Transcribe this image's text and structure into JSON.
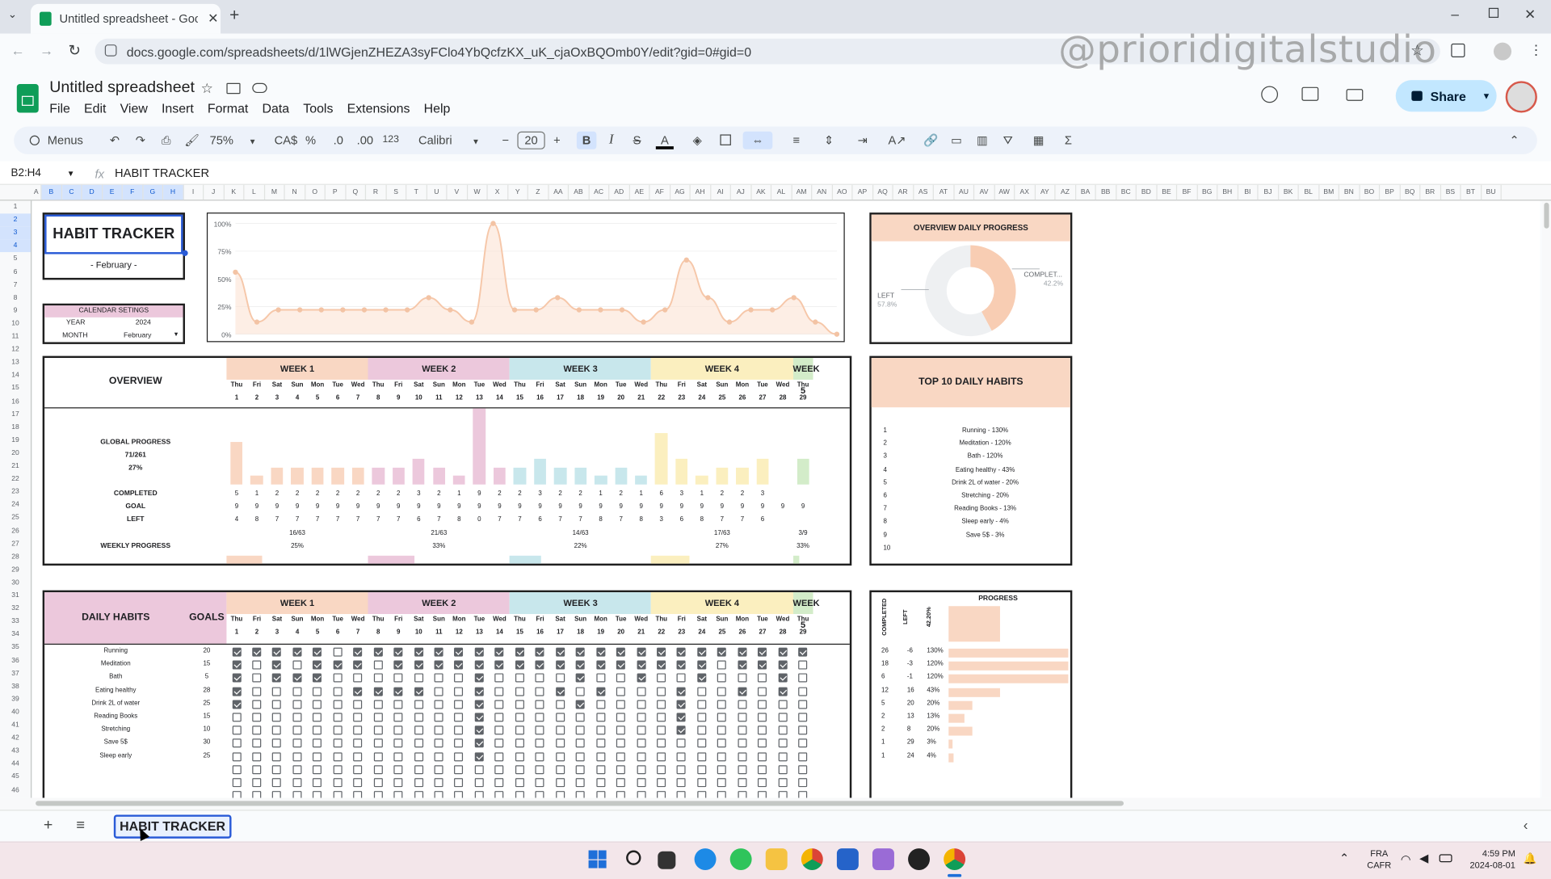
{
  "browser": {
    "tab_title": "Untitled spreadsheet - Google",
    "url": "docs.google.com/spreadsheets/d/1lWGjenZHEZA3syFClo4YbQcfzKX_uK_cjaOxBQOmb0Y/edit?gid=0#gid=0",
    "watermark": "@prioridigitalstudio"
  },
  "doc": {
    "title": "Untitled spreadsheet",
    "menus": [
      "File",
      "Edit",
      "View",
      "Insert",
      "Format",
      "Data",
      "Tools",
      "Extensions",
      "Help"
    ],
    "share_label": "Share"
  },
  "toolbar": {
    "search_label": "Menus",
    "zoom": "75%",
    "currency": "CA$",
    "percent": "%",
    "dec_minus": ".0",
    "dec_plus": ".00",
    "num_format": "123",
    "font": "Calibri",
    "font_size": "20",
    "bold": "B",
    "italic": "I"
  },
  "formula_bar": {
    "name_box": "B2:H4",
    "fx": "fx",
    "content": "HABIT TRACKER"
  },
  "columns": [
    "A",
    "B",
    "C",
    "D",
    "E",
    "F",
    "G",
    "H",
    "I",
    "J",
    "K",
    "L",
    "M",
    "N",
    "O",
    "P",
    "Q",
    "R",
    "S",
    "T",
    "U",
    "V",
    "W",
    "X",
    "Y",
    "Z",
    "AA",
    "AB",
    "AC",
    "AD",
    "AE",
    "AF",
    "AG",
    "AH",
    "AI",
    "AJ",
    "AK",
    "AL",
    "AM",
    "AN",
    "AO",
    "AP",
    "AQ",
    "AR",
    "AS",
    "AT",
    "AU",
    "AV",
    "AW",
    "AX",
    "AY",
    "AZ",
    "BA",
    "BB",
    "BC",
    "BD",
    "BE",
    "BF",
    "BG",
    "BH",
    "BI",
    "BJ",
    "BK",
    "BL",
    "BM",
    "BN",
    "BO",
    "BP",
    "BQ",
    "BR",
    "BS",
    "BT",
    "BU"
  ],
  "title_block": {
    "title": "HABIT TRACKER",
    "subtitle": "- February -"
  },
  "calendar_settings": {
    "header": "CALENDAR SETINGS",
    "year_label": "YEAR",
    "year": "2024",
    "month_label": "MONTH",
    "month": "February"
  },
  "line_chart": {
    "chart_data": {
      "type": "area",
      "ylim": [
        0,
        100
      ],
      "yticks": [
        "100%",
        "75%",
        "50%",
        "25%",
        "0%"
      ],
      "x": [
        1,
        2,
        3,
        4,
        5,
        6,
        7,
        8,
        9,
        10,
        11,
        12,
        13,
        14,
        15,
        16,
        17,
        18,
        19,
        20,
        21,
        22,
        23,
        24,
        25,
        26,
        27,
        28,
        29
      ],
      "values": [
        56,
        11,
        22,
        22,
        22,
        22,
        22,
        22,
        22,
        33,
        22,
        11,
        100,
        22,
        22,
        33,
        22,
        22,
        22,
        11,
        22,
        67,
        33,
        11,
        22,
        22,
        33,
        11,
        0
      ]
    }
  },
  "donut": {
    "title": "OVERVIEW DAILY PROGRESS",
    "chart_data": {
      "type": "pie",
      "labels": [
        "COMPLETED",
        "LEFT"
      ],
      "values": [
        42.2,
        57.8
      ]
    },
    "label_completed": "COMPLET...",
    "label_completed_pct": "42.2%",
    "label_left": "LEFT",
    "label_left_pct": "57.8%"
  },
  "weeks": [
    {
      "label": "WEEK 1",
      "color": "#f9d7c3"
    },
    {
      "label": "WEEK 2",
      "color": "#ecc8dc"
    },
    {
      "label": "WEEK 3",
      "color": "#c8e7ec"
    },
    {
      "label": "WEEK 4",
      "color": "#fbefbf"
    },
    {
      "label": "WEEK 5",
      "color": "#d3ecc9"
    }
  ],
  "days": [
    "Thu",
    "Fri",
    "Sat",
    "Sun",
    "Mon",
    "Tue",
    "Wed",
    "Thu",
    "Fri",
    "Sat",
    "Sun",
    "Mon",
    "Tue",
    "Wed",
    "Thu",
    "Fri",
    "Sat",
    "Sun",
    "Mon",
    "Tue",
    "Wed",
    "Thu",
    "Fri",
    "Sat",
    "Sun",
    "Mon",
    "Tue",
    "Wed",
    "Thu"
  ],
  "dates": [
    "1",
    "2",
    "3",
    "4",
    "5",
    "6",
    "7",
    "8",
    "9",
    "10",
    "11",
    "12",
    "13",
    "14",
    "15",
    "16",
    "17",
    "18",
    "19",
    "20",
    "21",
    "22",
    "23",
    "24",
    "25",
    "26",
    "27",
    "28",
    "29"
  ],
  "overview": {
    "title": "OVERVIEW",
    "global_label": "GLOBAL PROGRESS",
    "global_fraction": "71/261",
    "global_pct": "27%",
    "completed_label": "COMPLETED",
    "goal_label": "GOAL",
    "left_label": "LEFT",
    "weekly_label": "WEEKLY PROGRESS",
    "completed": [
      "5",
      "1",
      "2",
      "2",
      "2",
      "2",
      "2",
      "2",
      "2",
      "3",
      "2",
      "1",
      "9",
      "2",
      "2",
      "3",
      "2",
      "2",
      "1",
      "2",
      "1",
      "6",
      "3",
      "1",
      "2",
      "2",
      "3"
    ],
    "goal": [
      "9",
      "9",
      "9",
      "9",
      "9",
      "9",
      "9",
      "9",
      "9",
      "9",
      "9",
      "9",
      "9",
      "9",
      "9",
      "9",
      "9",
      "9",
      "9",
      "9",
      "9",
      "9",
      "9",
      "9",
      "9",
      "9",
      "9",
      "9",
      "9"
    ],
    "left": [
      "4",
      "8",
      "7",
      "7",
      "7",
      "7",
      "7",
      "7",
      "7",
      "6",
      "7",
      "8",
      "0",
      "7",
      "7",
      "6",
      "7",
      "7",
      "8",
      "7",
      "8",
      "3",
      "6",
      "8",
      "7",
      "7",
      "6"
    ],
    "weekly_fraction": [
      "16/63",
      "21/63",
      "14/63",
      "17/63",
      "3/9"
    ],
    "weekly_pct": [
      "25%",
      "33%",
      "22%",
      "27%",
      "33%"
    ],
    "weekly_fill": [
      0.25,
      0.33,
      0.22,
      0.27,
      0.33
    ],
    "chart_data": {
      "type": "bar",
      "values": [
        5,
        1,
        2,
        2,
        2,
        2,
        2,
        2,
        2,
        3,
        2,
        1,
        9,
        2,
        2,
        3,
        2,
        2,
        1,
        2,
        1,
        6,
        3,
        1,
        2,
        2,
        3,
        0,
        3
      ]
    }
  },
  "top10": {
    "title": "TOP 10 DAILY HABITS",
    "ranks": [
      "1",
      "2",
      "3",
      "4",
      "5",
      "6",
      "7",
      "8",
      "9",
      "10"
    ],
    "items": [
      "Running - 130%",
      "Meditation - 120%",
      "Bath - 120%",
      "Eating healthy - 43%",
      "Drink 2L of water - 20%",
      "Stretching - 20%",
      "Reading Books - 13%",
      "Sleep early - 4%",
      "Save 5$ - 3%",
      ""
    ]
  },
  "habits": {
    "title": "DAILY HABITS",
    "goals_label": "GOALS",
    "names": [
      "Running",
      "Meditation",
      "Bath",
      "Eating healthy",
      "Drink 2L of water",
      "Reading Books",
      "Stretching",
      "Save 5$",
      "Sleep early"
    ],
    "goals": [
      "20",
      "15",
      "5",
      "28",
      "25",
      "15",
      "10",
      "30",
      "25"
    ],
    "checks": [
      [
        1,
        1,
        1,
        1,
        1,
        0,
        1,
        1,
        1,
        1,
        1,
        1,
        1,
        1,
        1,
        1,
        1,
        1,
        1,
        1,
        1,
        1,
        1,
        1,
        1,
        1,
        1,
        1,
        1
      ],
      [
        1,
        0,
        1,
        0,
        1,
        1,
        1,
        0,
        1,
        1,
        1,
        1,
        1,
        1,
        1,
        1,
        1,
        1,
        1,
        1,
        1,
        1,
        1,
        1,
        0,
        1,
        1,
        1,
        0
      ],
      [
        1,
        0,
        1,
        1,
        1,
        0,
        0,
        0,
        0,
        0,
        0,
        0,
        1,
        0,
        0,
        0,
        0,
        1,
        0,
        0,
        1,
        0,
        0,
        1,
        0,
        0,
        0,
        1,
        0
      ],
      [
        1,
        0,
        0,
        0,
        0,
        0,
        1,
        1,
        1,
        1,
        0,
        0,
        1,
        0,
        0,
        0,
        1,
        0,
        1,
        0,
        0,
        0,
        1,
        0,
        0,
        1,
        0,
        1,
        0
      ],
      [
        1,
        0,
        0,
        0,
        0,
        0,
        0,
        0,
        0,
        0,
        0,
        0,
        1,
        0,
        0,
        0,
        0,
        1,
        0,
        0,
        0,
        0,
        1,
        0,
        0,
        0,
        0,
        0,
        0
      ],
      [
        0,
        0,
        0,
        0,
        0,
        0,
        0,
        0,
        0,
        0,
        0,
        0,
        1,
        0,
        0,
        0,
        0,
        0,
        0,
        0,
        0,
        0,
        1,
        0,
        0,
        0,
        0,
        0,
        0
      ],
      [
        0,
        0,
        0,
        0,
        0,
        0,
        0,
        0,
        0,
        0,
        0,
        0,
        1,
        0,
        0,
        0,
        0,
        0,
        0,
        0,
        0,
        0,
        1,
        0,
        0,
        0,
        0,
        0,
        0
      ],
      [
        0,
        0,
        0,
        0,
        0,
        0,
        0,
        0,
        0,
        0,
        0,
        0,
        1,
        0,
        0,
        0,
        0,
        0,
        0,
        0,
        0,
        0,
        0,
        0,
        0,
        0,
        0,
        0,
        0
      ],
      [
        0,
        0,
        0,
        0,
        0,
        0,
        0,
        0,
        0,
        0,
        0,
        0,
        1,
        0,
        0,
        0,
        0,
        0,
        0,
        0,
        0,
        0,
        0,
        0,
        0,
        0,
        0,
        0,
        0
      ]
    ],
    "empty_rows": 3
  },
  "progress_panel": {
    "header": "PROGRESS",
    "col_completed": "COMPLETED",
    "col_left": "LEFT",
    "col_pct": "42.20%",
    "completed": [
      "26",
      "18",
      "6",
      "12",
      "5",
      "2",
      "2",
      "1",
      "1"
    ],
    "left": [
      "-6",
      "-3",
      "-1",
      "16",
      "20",
      "13",
      "8",
      "29",
      "24"
    ],
    "pct": [
      "130%",
      "120%",
      "120%",
      "43%",
      "20%",
      "13%",
      "20%",
      "3%",
      "4%"
    ],
    "fill": [
      1.3,
      1.2,
      1.2,
      0.43,
      0.2,
      0.13,
      0.2,
      0.03,
      0.04
    ]
  },
  "sheet_tab": "HABIT TRACKER",
  "taskbar": {
    "lang": "FRA",
    "kbd": "CAFR",
    "time": "4:59 PM",
    "date": "2024-08-01"
  },
  "colors": {
    "accent": "#f9d7c3",
    "chart_line": "#f6c7a9",
    "sheets_green": "#0f9d58"
  }
}
